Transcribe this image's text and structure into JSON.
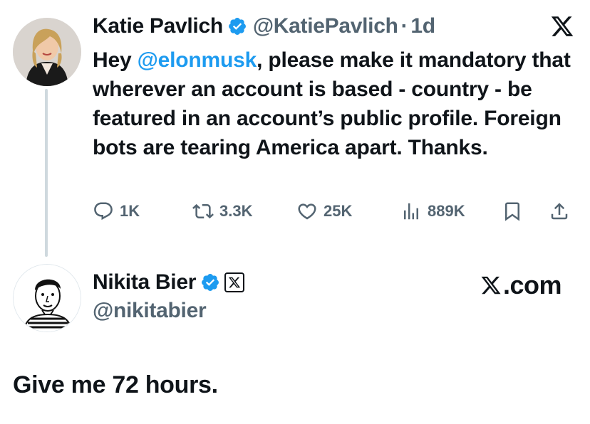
{
  "tweet": {
    "author_name": "Katie Pavlich",
    "handle": "@KatiePavlich",
    "separator": "·",
    "time": "1d",
    "text_prefix": "Hey ",
    "mention": "@elonmusk",
    "text_suffix": ", please make it mandatory that wherever an account is based - country - be featured in an account’s public profile. Foreign bots are tearing America apart. Thanks.",
    "stats": {
      "replies": "1K",
      "reposts": "3.3K",
      "likes": "25K",
      "views": "889K"
    }
  },
  "reply": {
    "author_name": "Nikita Bier",
    "handle": "@nikitabier",
    "brand": ".com",
    "text": "Give me 72 hours."
  },
  "icons": {
    "verified": "verified-badge-icon",
    "affiliate": "x-affiliate-icon",
    "x_logo": "x-logo-icon",
    "reply": "comment-icon",
    "repost": "repost-icon",
    "like": "heart-icon",
    "views": "views-icon",
    "bookmark": "bookmark-icon",
    "share": "share-icon"
  },
  "colors": {
    "text": "#0f1419",
    "secondary": "#536471",
    "accent": "#1d9bf0",
    "thread_line": "#cfd9de"
  }
}
